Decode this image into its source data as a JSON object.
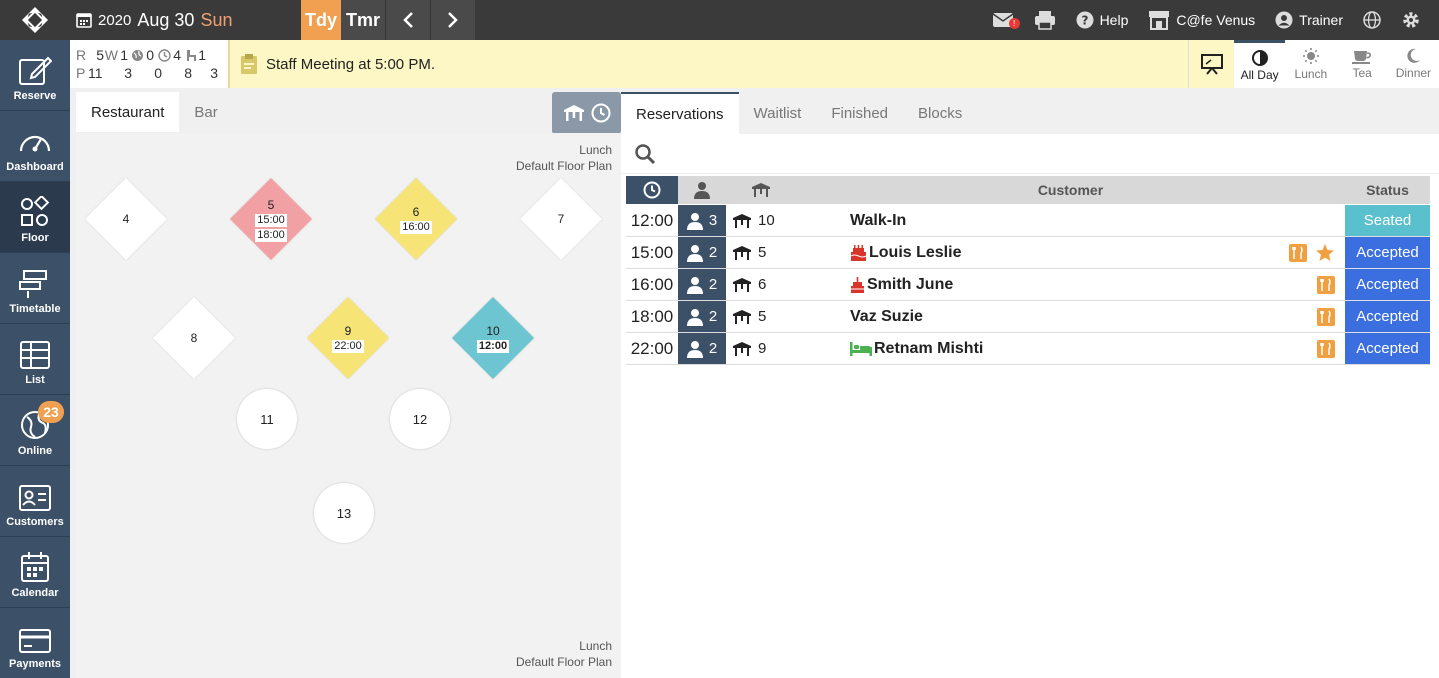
{
  "header": {
    "year": "2020",
    "date": "Aug 30",
    "weekday": "Sun",
    "today_label": "Tdy",
    "tomorrow_label": "Tmr",
    "help_label": "Help",
    "restaurant_name": "C@fe Venus",
    "user_name": "Trainer",
    "mail_badge": "!"
  },
  "sidebar": {
    "items": [
      {
        "label": "Reserve",
        "icon": "pencil-square-icon"
      },
      {
        "label": "Dashboard",
        "icon": "gauge-icon"
      },
      {
        "label": "Floor",
        "icon": "shapes-icon"
      },
      {
        "label": "Timetable",
        "icon": "timetable-icon"
      },
      {
        "label": "List",
        "icon": "table-list-icon"
      },
      {
        "label": "Online",
        "icon": "globe-icon",
        "badge": "23"
      },
      {
        "label": "Customers",
        "icon": "id-card-icon"
      },
      {
        "label": "Calendar",
        "icon": "calendar-icon"
      },
      {
        "label": "Payments",
        "icon": "credit-card-icon"
      }
    ]
  },
  "stats": {
    "r_label": "R",
    "r_val": "5",
    "w_label": "W",
    "w_val": "1",
    "online_val": "0",
    "clock_val": "4",
    "seat_val": "1",
    "p_label": "P",
    "p_val": "11",
    "p2": "3",
    "p3": "0",
    "p4": "8",
    "p5": "3"
  },
  "notice": {
    "text": "Staff Meeting at 5:00 PM."
  },
  "meals": [
    {
      "label": "All Day",
      "icon": "half-circle-icon",
      "active": true
    },
    {
      "label": "Lunch",
      "icon": "sun-icon"
    },
    {
      "label": "Tea",
      "icon": "teacup-icon"
    },
    {
      "label": "Dinner",
      "icon": "moon-icon"
    }
  ],
  "floor": {
    "tabs": [
      "Restaurant",
      "Bar"
    ],
    "plan_meal": "Lunch",
    "plan_name": "Default Floor Plan",
    "tables": [
      {
        "num": "4"
      },
      {
        "num": "5",
        "times": [
          "15:00",
          "18:00"
        ]
      },
      {
        "num": "6",
        "times": [
          "16:00"
        ]
      },
      {
        "num": "7"
      },
      {
        "num": "8"
      },
      {
        "num": "9",
        "times": [
          "22:00"
        ]
      },
      {
        "num": "10",
        "times": [
          "12:00"
        ]
      },
      {
        "num": "11"
      },
      {
        "num": "12"
      },
      {
        "num": "13"
      }
    ],
    "colors": {
      "red": "#f1a1a4",
      "yellow": "#f7e476",
      "teal": "#6cc5d0"
    }
  },
  "reservations": {
    "tabs": [
      "Reservations",
      "Waitlist",
      "Finished",
      "Blocks"
    ],
    "columns": {
      "customer": "Customer",
      "status": "Status"
    },
    "rows": [
      {
        "time": "12:00",
        "pax": "3",
        "table": "10",
        "customer": "Walk-In",
        "status": "Seated",
        "status_color": "#5bc0cd"
      },
      {
        "time": "15:00",
        "pax": "2",
        "table": "5",
        "customer": "Louis Leslie",
        "prefix": "birthday-cake-icon",
        "status": "Accepted",
        "status_color": "#3b6fe0"
      },
      {
        "time": "16:00",
        "pax": "2",
        "table": "6",
        "customer": "Smith June",
        "prefix": "cake-icon",
        "status": "Accepted",
        "status_color": "#3b6fe0"
      },
      {
        "time": "18:00",
        "pax": "2",
        "table": "5",
        "customer": "Vaz Suzie",
        "status": "Accepted",
        "status_color": "#3b6fe0"
      },
      {
        "time": "22:00",
        "pax": "2",
        "table": "9",
        "customer": "Retnam Mishti",
        "prefix": "bed-icon",
        "status": "Accepted",
        "status_color": "#3b6fe0"
      }
    ]
  }
}
